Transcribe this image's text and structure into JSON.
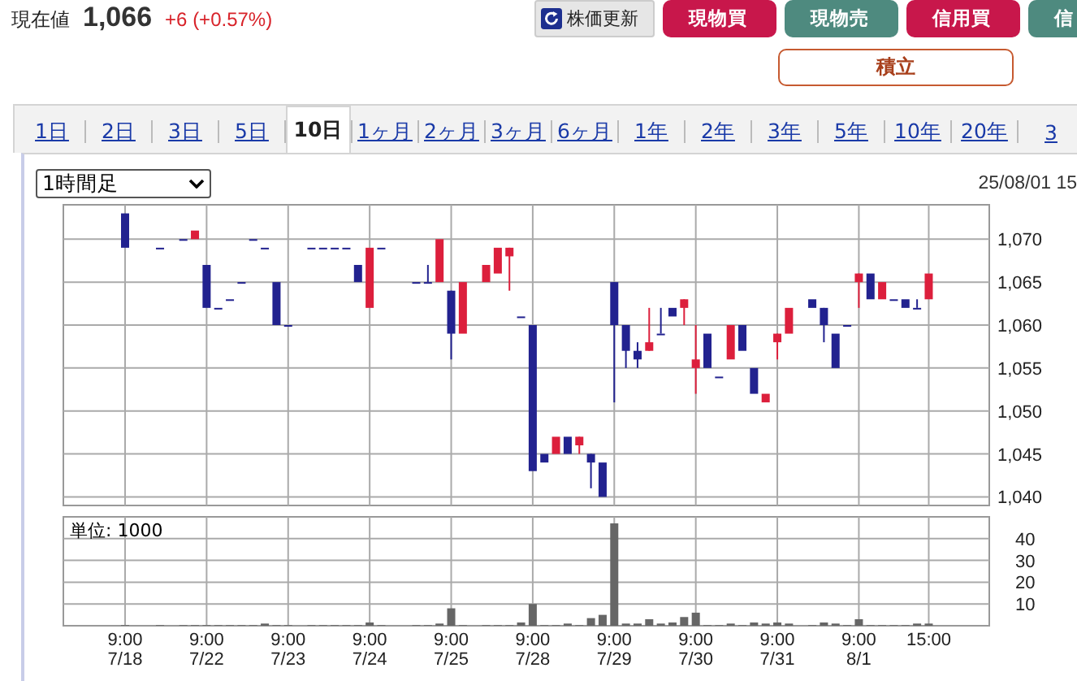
{
  "quote": {
    "label": "現在値",
    "price": "1,066",
    "change": "+6 (+0.57%)"
  },
  "buttons": [
    {
      "label": "株価更新",
      "kind": "refresh"
    },
    {
      "label": "現物買",
      "kind": "buy"
    },
    {
      "label": "現物売",
      "kind": "sell"
    },
    {
      "label": "信用買",
      "kind": "buy"
    },
    {
      "label": "信",
      "kind": "sell"
    }
  ],
  "accumulate_button": "積立",
  "tabs": [
    {
      "label": "1日",
      "selected": false
    },
    {
      "label": "2日",
      "selected": false
    },
    {
      "label": "3日",
      "selected": false
    },
    {
      "label": "5日",
      "selected": false
    },
    {
      "label": "10日",
      "selected": true
    },
    {
      "label": "1ヶ月",
      "selected": false
    },
    {
      "label": "2ヶ月",
      "selected": false
    },
    {
      "label": "3ヶ月",
      "selected": false
    },
    {
      "label": "6ヶ月",
      "selected": false
    },
    {
      "label": "1年",
      "selected": false
    },
    {
      "label": "2年",
      "selected": false
    },
    {
      "label": "3年",
      "selected": false
    },
    {
      "label": "5年",
      "selected": false
    },
    {
      "label": "10年",
      "selected": false
    },
    {
      "label": "20年",
      "selected": false
    },
    {
      "label": "3",
      "selected": false
    }
  ],
  "interval_select": "1時間足",
  "timestamp": "25/08/01 15",
  "price_chart": {
    "chart_data": {
      "type": "candlestick",
      "grid": true,
      "ylim": [
        1039,
        1074
      ],
      "yticks": [
        {
          "value": 1040,
          "label": "1,040"
        },
        {
          "value": 1045,
          "label": "1,045"
        },
        {
          "value": 1050,
          "label": "1,050"
        },
        {
          "value": 1055,
          "label": "1,055"
        },
        {
          "value": 1060,
          "label": "1,060"
        },
        {
          "value": 1065,
          "label": "1,065"
        },
        {
          "value": 1070,
          "label": "1,070"
        }
      ],
      "categories": [
        null,
        null,
        null,
        null,
        null,
        null,
        null,
        null,
        null,
        null,
        null,
        null,
        null,
        null,
        null,
        null,
        null,
        null,
        null,
        null,
        null,
        null,
        null,
        null,
        null,
        null,
        null,
        null,
        null,
        null,
        null,
        null,
        null,
        null,
        null,
        null,
        null,
        null,
        null,
        null,
        null,
        null,
        null,
        null,
        null,
        null,
        null,
        null,
        null,
        null,
        null,
        null,
        null,
        null,
        null,
        null,
        null,
        null,
        null,
        null,
        null,
        null,
        null,
        null,
        null,
        null,
        null,
        null,
        null,
        null
      ],
      "ohlc": [
        [
          1073,
          1073,
          1069,
          1069
        ],
        null,
        null,
        [
          1069,
          1069,
          1069,
          1069
        ],
        null,
        [
          1070,
          1070,
          1070,
          1070
        ],
        [
          1070,
          1071,
          1070,
          1071
        ],
        [
          1067,
          1067,
          1062,
          1062
        ],
        [
          1062,
          1062,
          1062,
          1062
        ],
        [
          1063,
          1063,
          1063,
          1063
        ],
        [
          1065,
          1065,
          1065,
          1065
        ],
        [
          1070,
          1070,
          1070,
          1070
        ],
        [
          1069,
          1069,
          1069,
          1069
        ],
        [
          1065,
          1065,
          1060,
          1060
        ],
        [
          1060,
          1060,
          1060,
          1060
        ],
        null,
        [
          1069,
          1069,
          1069,
          1069
        ],
        [
          1069,
          1069,
          1069,
          1069
        ],
        [
          1069,
          1069,
          1069,
          1069
        ],
        [
          1069,
          1069,
          1069,
          1069
        ],
        [
          1067,
          1067,
          1065,
          1065
        ],
        [
          1062,
          1069,
          1062,
          1069
        ],
        [
          1069,
          1069,
          1069,
          1069
        ],
        null,
        null,
        [
          1065,
          1065,
          1065,
          1065
        ],
        [
          1065,
          1067,
          1065,
          1065
        ],
        [
          1065,
          1070,
          1065,
          1070
        ],
        [
          1064,
          1064,
          1056,
          1059
        ],
        [
          1059,
          1065,
          1059,
          1065
        ],
        null,
        [
          1065,
          1067,
          1065,
          1067
        ],
        [
          1066,
          1069,
          1066,
          1069
        ],
        [
          1068,
          1069,
          1064,
          1069
        ],
        [
          1061,
          1061,
          1061,
          1061
        ],
        [
          1060,
          1060,
          1043,
          1043
        ],
        [
          1045,
          1045,
          1044,
          1044
        ],
        [
          1045,
          1047,
          1045,
          1047
        ],
        [
          1047,
          1047,
          1045,
          1045
        ],
        [
          1046,
          1047,
          1045,
          1047
        ],
        [
          1045,
          1045,
          1041,
          1044
        ],
        [
          1044,
          1044,
          1040,
          1040
        ],
        [
          1065,
          1065,
          1051,
          1060
        ],
        [
          1060,
          1060,
          1055,
          1057
        ],
        [
          1057,
          1058,
          1055,
          1056
        ],
        [
          1057,
          1062,
          1057,
          1058
        ],
        [
          1059,
          1062,
          1059,
          1059
        ],
        [
          1062,
          1062,
          1061,
          1061
        ],
        [
          1062,
          1063,
          1060,
          1063
        ],
        [
          1055,
          1060,
          1052,
          1056
        ],
        [
          1059,
          1059,
          1055,
          1055
        ],
        [
          1054,
          1054,
          1054,
          1054
        ],
        [
          1056,
          1060,
          1056,
          1060
        ],
        [
          1060,
          1060,
          1057,
          1057
        ],
        [
          1055,
          1055,
          1052,
          1052
        ],
        [
          1051,
          1052,
          1051,
          1052
        ],
        [
          1058,
          1059,
          1056,
          1059
        ],
        [
          1059,
          1062,
          1059,
          1062
        ],
        null,
        [
          1063,
          1063,
          1062,
          1062
        ],
        [
          1062,
          1062,
          1058,
          1060
        ],
        [
          1059,
          1059,
          1055,
          1055
        ],
        [
          1060,
          1060,
          1060,
          1060
        ],
        [
          1065,
          1066,
          1062,
          1066
        ],
        [
          1066,
          1066,
          1063,
          1063
        ],
        [
          1063,
          1065,
          1063,
          1065
        ],
        [
          1063,
          1063,
          1063,
          1063
        ],
        [
          1063,
          1063,
          1062,
          1062
        ],
        [
          1062,
          1063,
          1062,
          1062
        ],
        [
          1063,
          1066,
          1063,
          1066
        ]
      ]
    }
  },
  "volume_chart": {
    "unit_label": "単位: 1000",
    "chart_data": {
      "type": "bar",
      "grid": true,
      "ylim": [
        0,
        50
      ],
      "yticks": [
        10,
        20,
        30,
        40
      ],
      "categories": [
        "9:00 7/18",
        null,
        null,
        null,
        null,
        null,
        null,
        "9:00 7/22",
        null,
        null,
        null,
        null,
        null,
        null,
        "9:00 7/23",
        null,
        null,
        null,
        null,
        null,
        null,
        "9:00 7/24",
        null,
        null,
        null,
        null,
        null,
        null,
        "9:00 7/25",
        null,
        null,
        null,
        null,
        null,
        null,
        "9:00 7/28",
        null,
        null,
        null,
        null,
        null,
        null,
        "9:00 7/29",
        null,
        null,
        null,
        null,
        null,
        null,
        "9:00 7/30",
        null,
        null,
        null,
        null,
        null,
        null,
        "9:00 7/31",
        null,
        null,
        null,
        null,
        null,
        null,
        "9:00 8/1",
        null,
        null,
        null,
        null,
        null,
        "15:00"
      ],
      "values": [
        0.3,
        null,
        null,
        0.3,
        null,
        0.3,
        0.3,
        0.3,
        0.3,
        0.3,
        0.3,
        0.3,
        1,
        0.3,
        0.3,
        null,
        0.3,
        0.3,
        0.3,
        0.3,
        0.3,
        1.5,
        0.3,
        null,
        null,
        0.3,
        0.3,
        1,
        8,
        0.3,
        null,
        0.3,
        0.3,
        0.3,
        1.5,
        10,
        0.3,
        0.3,
        1,
        0.3,
        3.5,
        5,
        47,
        1,
        1,
        3,
        1,
        1.5,
        4,
        6,
        0.3,
        0.3,
        1,
        0.3,
        1.5,
        1,
        1.5,
        1,
        null,
        0.3,
        1.5,
        1,
        0.3,
        3,
        0.3,
        0.3,
        0.3,
        0.3,
        1,
        1
      ]
    }
  }
}
